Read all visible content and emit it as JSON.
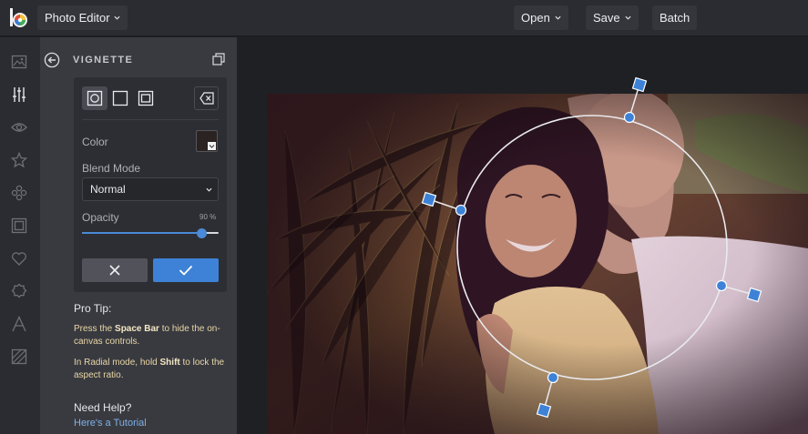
{
  "topbar": {
    "app_title": "Photo Editor",
    "open_label": "Open",
    "save_label": "Save",
    "batch_label": "Batch"
  },
  "rail": {
    "icons": [
      "image-icon",
      "adjust-sliders-icon",
      "eye-icon",
      "star-icon",
      "effects-icon",
      "frame-icon",
      "heart-icon",
      "badge-icon",
      "text-icon",
      "texture-icon"
    ]
  },
  "panel": {
    "title": "VIGNETTE",
    "shapes": [
      "radial",
      "square",
      "rectangle"
    ],
    "color_label": "Color",
    "color_value": "#2a2322",
    "blend_label": "Blend Mode",
    "blend_value": "Normal",
    "opacity_label": "Opacity",
    "opacity_value": "90 %",
    "opacity_fraction": 0.87
  },
  "tips": {
    "title": "Pro Tip:",
    "line1_a": "Press the ",
    "line1_b": "Space Bar",
    "line1_c": " to hide the on-canvas controls.",
    "line2_a": "In Radial mode, hold ",
    "line2_b": "Shift",
    "line2_c": " to lock the aspect ratio.",
    "help_title": "Need Help?",
    "help_link": "Here's a Tutorial"
  },
  "colors": {
    "accent": "#3d82d6",
    "panel": "#393a40",
    "topbar": "#2b2c31"
  }
}
